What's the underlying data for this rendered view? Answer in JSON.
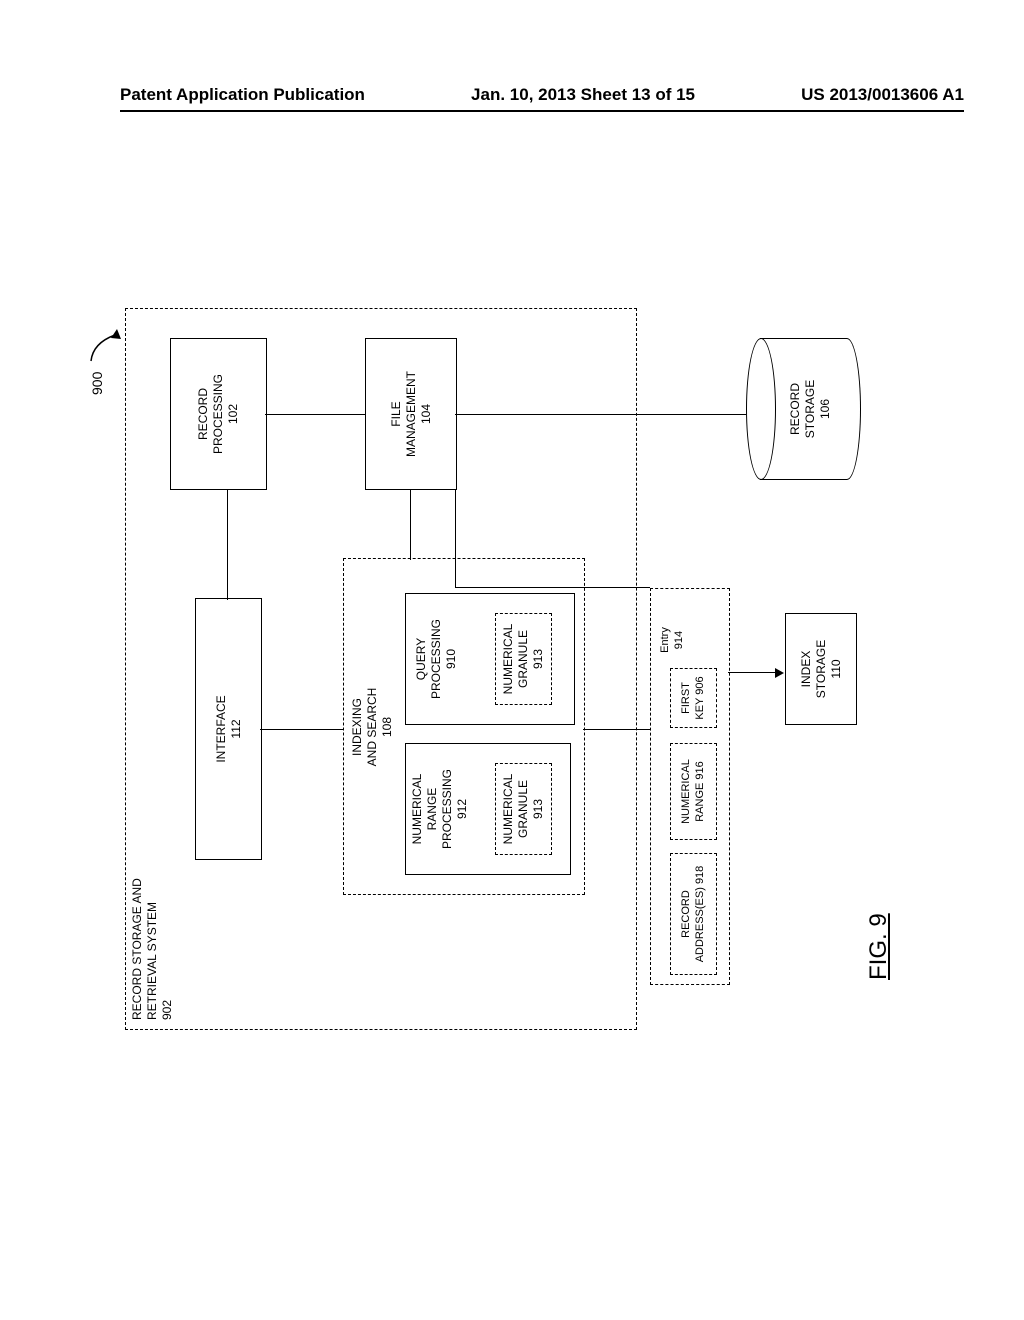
{
  "header": {
    "left": "Patent Application Publication",
    "center": "Jan. 10, 2013  Sheet 13 of 15",
    "right": "US 2013/0013606 A1"
  },
  "ref_label": "900",
  "fig_label": "FIG. 9",
  "blocks": {
    "system_title": "RECORD STORAGE AND\nRETRIEVAL SYSTEM\n902",
    "interface": "INTERFACE\n112",
    "record_processing": "RECORD\nPROCESSING\n102",
    "file_management": "FILE\nMANAGEMENT\n104",
    "indexing": "INDEXING\nAND SEARCH\n108",
    "query_processing": "QUERY\nPROCESSING\n910",
    "query_granule": "NUMERICAL\nGRANULE\n913",
    "range_processing": "NUMERICAL\nRANGE\nPROCESSING\n912",
    "range_granule": "NUMERICAL\nGRANULE\n913",
    "entry": "Entry\n914",
    "first_key": "FIRST\nKEY 906",
    "numerical_range": "NUMERICAL\nRANGE 916",
    "record_addresses": "RECORD\nADDRESS(ES) 918",
    "record_storage": "RECORD\nSTORAGE\n106",
    "index_storage": "INDEX\nSTORAGE\n110"
  }
}
